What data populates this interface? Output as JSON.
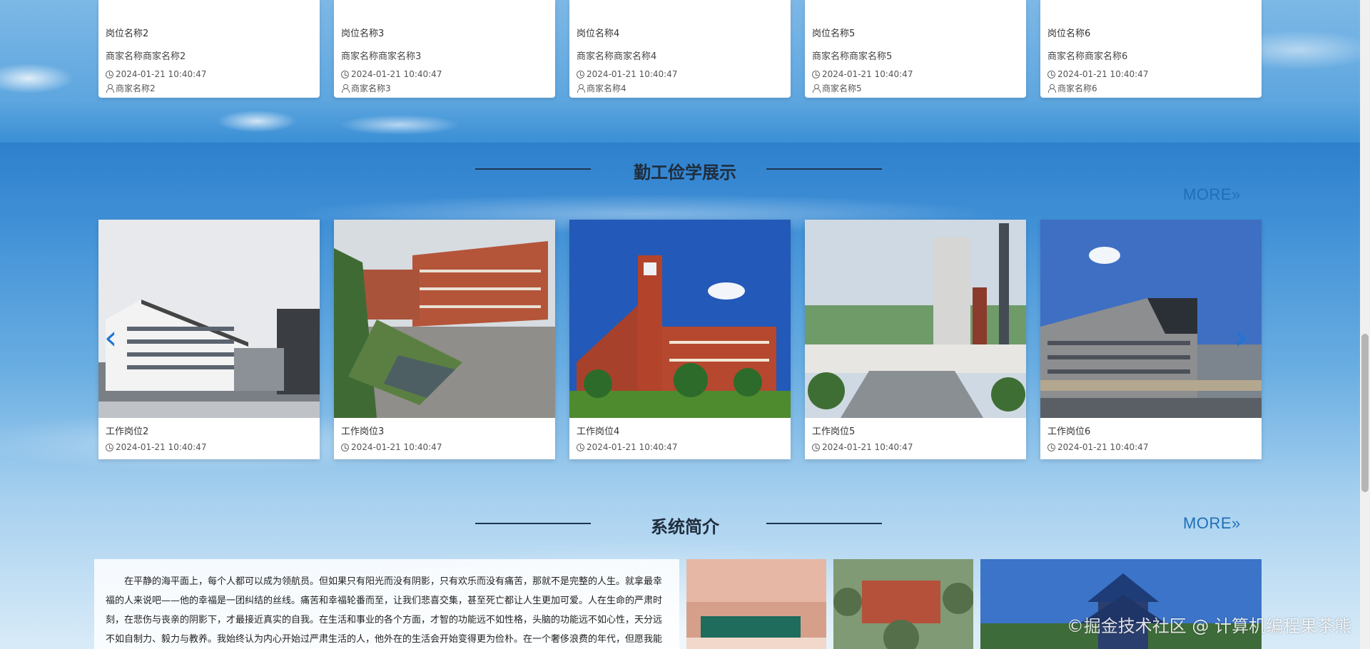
{
  "top_cards": [
    {
      "job": "岗位名称2",
      "biz": "商家名称商家名称2",
      "time": "2024-01-21 10:40:47",
      "seller": "商家名称2"
    },
    {
      "job": "岗位名称3",
      "biz": "商家名称商家名称3",
      "time": "2024-01-21 10:40:47",
      "seller": "商家名称3"
    },
    {
      "job": "岗位名称4",
      "biz": "商家名称商家名称4",
      "time": "2024-01-21 10:40:47",
      "seller": "商家名称4"
    },
    {
      "job": "岗位名称5",
      "biz": "商家名称商家名称5",
      "time": "2024-01-21 10:40:47",
      "seller": "商家名称5"
    },
    {
      "job": "岗位名称6",
      "biz": "商家名称商家名称6",
      "time": "2024-01-21 10:40:47",
      "seller": "商家名称6"
    }
  ],
  "showcase": {
    "title": "勤工俭学展示",
    "more": "MORE»",
    "prev_icon": "chevron-left-icon",
    "next_icon": "chevron-right-icon",
    "items": [
      {
        "title": "工作岗位2",
        "time": "2024-01-21 10:40:47"
      },
      {
        "title": "工作岗位3",
        "time": "2024-01-21 10:40:47"
      },
      {
        "title": "工作岗位4",
        "time": "2024-01-21 10:40:47"
      },
      {
        "title": "工作岗位5",
        "time": "2024-01-21 10:40:47"
      },
      {
        "title": "工作岗位6",
        "time": "2024-01-21 10:40:47"
      }
    ]
  },
  "intro": {
    "title": "系统简介",
    "more": "MORE»",
    "text": "在平静的海平面上，每个人都可以成为领航员。但如果只有阳光而没有阴影，只有欢乐而没有痛苦，那就不是完整的人生。就拿最幸福的人来说吧——他的幸福是一团纠结的丝线。痛苦和幸福轮番而至，让我们悲喜交集，甚至死亡都让人生更加可爱。人在生命的严肃时刻，在悲伤与丧亲的阴影下，才最接近真实的自我。在生活和事业的各个方面，才智的功能远不如性格，头脑的功能远不如心性，天分远不如自制力、毅力与教养。我始终认为内心开始过严肃生活的人，他外在的生活会开始变得更为俭朴。在一个奢侈浪费的年代，但愿我能让世人了解：人类真正的需求是多么的稀少。不重蹈覆辙才是真正的醒悟。比别人优秀并"
  },
  "watermark": "©掘金技术社区 @ 计算机编程果茶熊"
}
